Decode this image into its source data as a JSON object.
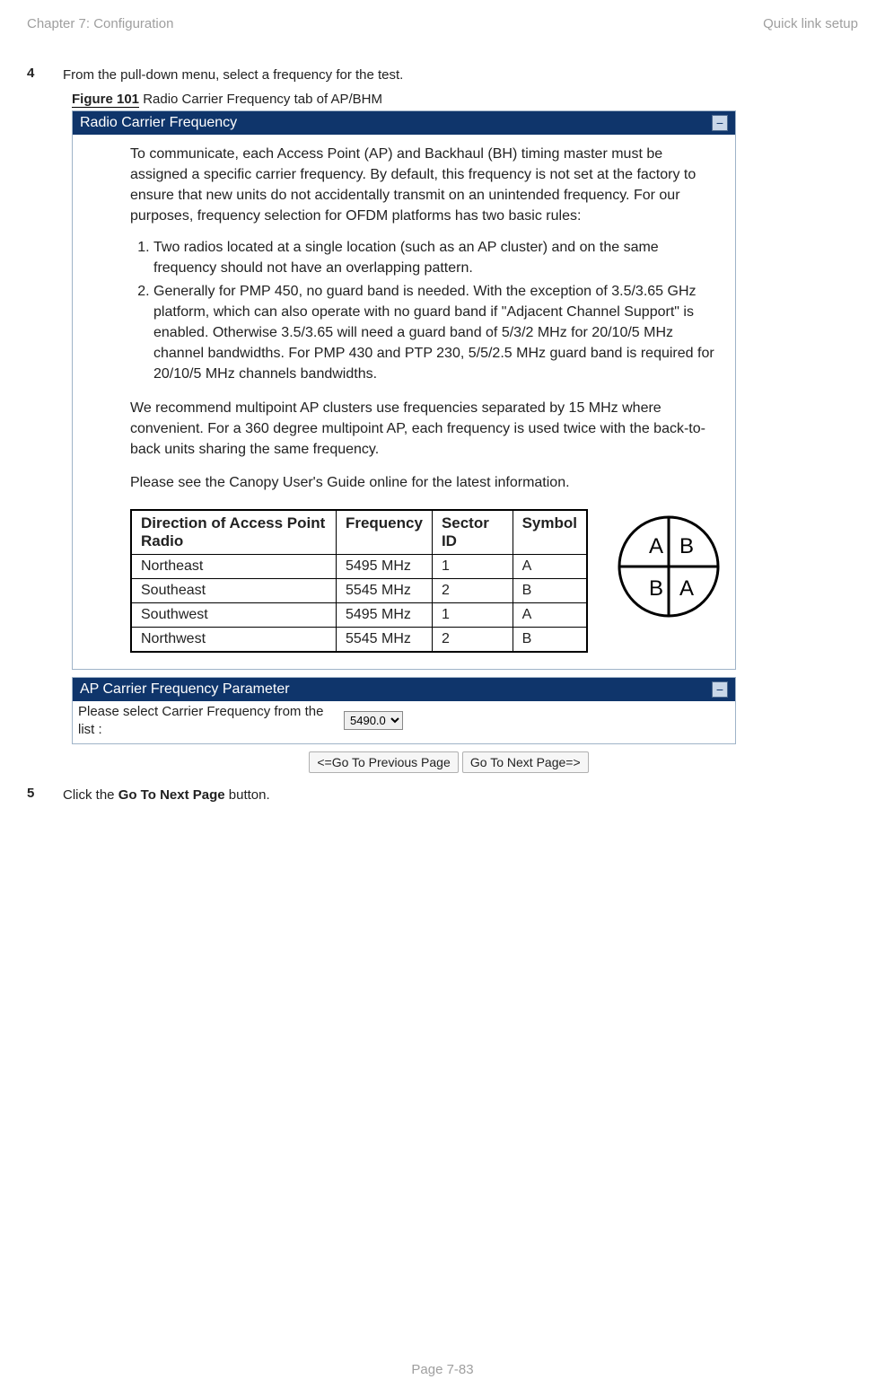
{
  "header": {
    "left": "Chapter 7:  Configuration",
    "right": "Quick link setup"
  },
  "steps": {
    "4": {
      "num": "4",
      "text": "From the pull-down menu, select a frequency for the test."
    },
    "figure": {
      "label": "Figure 101",
      "caption": " Radio Carrier Frequency tab of AP/BHM"
    },
    "5": {
      "num": "5",
      "text_pre": "Click the ",
      "text_bold": "Go To Next Page",
      "text_post": " button."
    }
  },
  "panel1": {
    "title": "Radio Carrier Frequency",
    "collapse_glyph": "−",
    "intro": "To communicate, each Access Point (AP) and Backhaul (BH) timing master must be assigned a specific carrier frequency. By default, this frequency is not set at the factory to ensure that new units do not accidentally transmit on an unintended frequency. For our purposes, frequency selection for OFDM platforms has two basic rules:",
    "rule1": "Two radios located at a single location (such as an AP cluster) and on the same frequency should not have an overlapping pattern.",
    "rule2": "Generally for PMP 450, no guard band is needed. With the exception of 3.5/3.65 GHz platform, which can also operate with no guard band if \"Adjacent Channel Support\" is enabled. Otherwise 3.5/3.65 will need a guard band of 5/3/2 MHz for 20/10/5 MHz channel bandwidths. For PMP 430 and PTP 230, 5/5/2.5 MHz guard band is required for 20/10/5 MHz channels bandwidths.",
    "recommend": "We recommend multipoint AP clusters use frequencies separated by 15 MHz where convenient. For a 360 degree multipoint AP, each frequency is used twice with the back-to-back units sharing the same frequency.",
    "see": "Please see the Canopy User's Guide online for the latest information.",
    "table": {
      "headers": [
        "Direction of Access Point Radio",
        "Frequency",
        "Sector ID",
        "Symbol"
      ],
      "rows": [
        [
          "Northeast",
          "5495 MHz",
          "1",
          "A"
        ],
        [
          "Southeast",
          "5545 MHz",
          "2",
          "B"
        ],
        [
          "Southwest",
          "5495 MHz",
          "1",
          "A"
        ],
        [
          "Northwest",
          "5545 MHz",
          "2",
          "B"
        ]
      ]
    },
    "diagram_labels": {
      "tl": "A",
      "tr": "B",
      "bl": "B",
      "br": "A"
    }
  },
  "panel2": {
    "title": "AP Carrier Frequency Parameter",
    "collapse_glyph": "−",
    "label": "Please select Carrier Frequency from the list :",
    "selected": "5490.0"
  },
  "nav": {
    "prev": "<=Go To Previous Page",
    "next": "Go To Next Page=>"
  },
  "footer": "Page 7-83",
  "chart_data": {
    "type": "table",
    "title": "Radio Carrier Frequency tab of AP/BHM",
    "columns": [
      "Direction of Access Point Radio",
      "Frequency",
      "Sector ID",
      "Symbol"
    ],
    "rows": [
      {
        "direction": "Northeast",
        "frequency_mhz": 5495,
        "sector_id": 1,
        "symbol": "A"
      },
      {
        "direction": "Southeast",
        "frequency_mhz": 5545,
        "sector_id": 2,
        "symbol": "B"
      },
      {
        "direction": "Southwest",
        "frequency_mhz": 5495,
        "sector_id": 1,
        "symbol": "A"
      },
      {
        "direction": "Northwest",
        "frequency_mhz": 5545,
        "sector_id": 2,
        "symbol": "B"
      }
    ]
  }
}
